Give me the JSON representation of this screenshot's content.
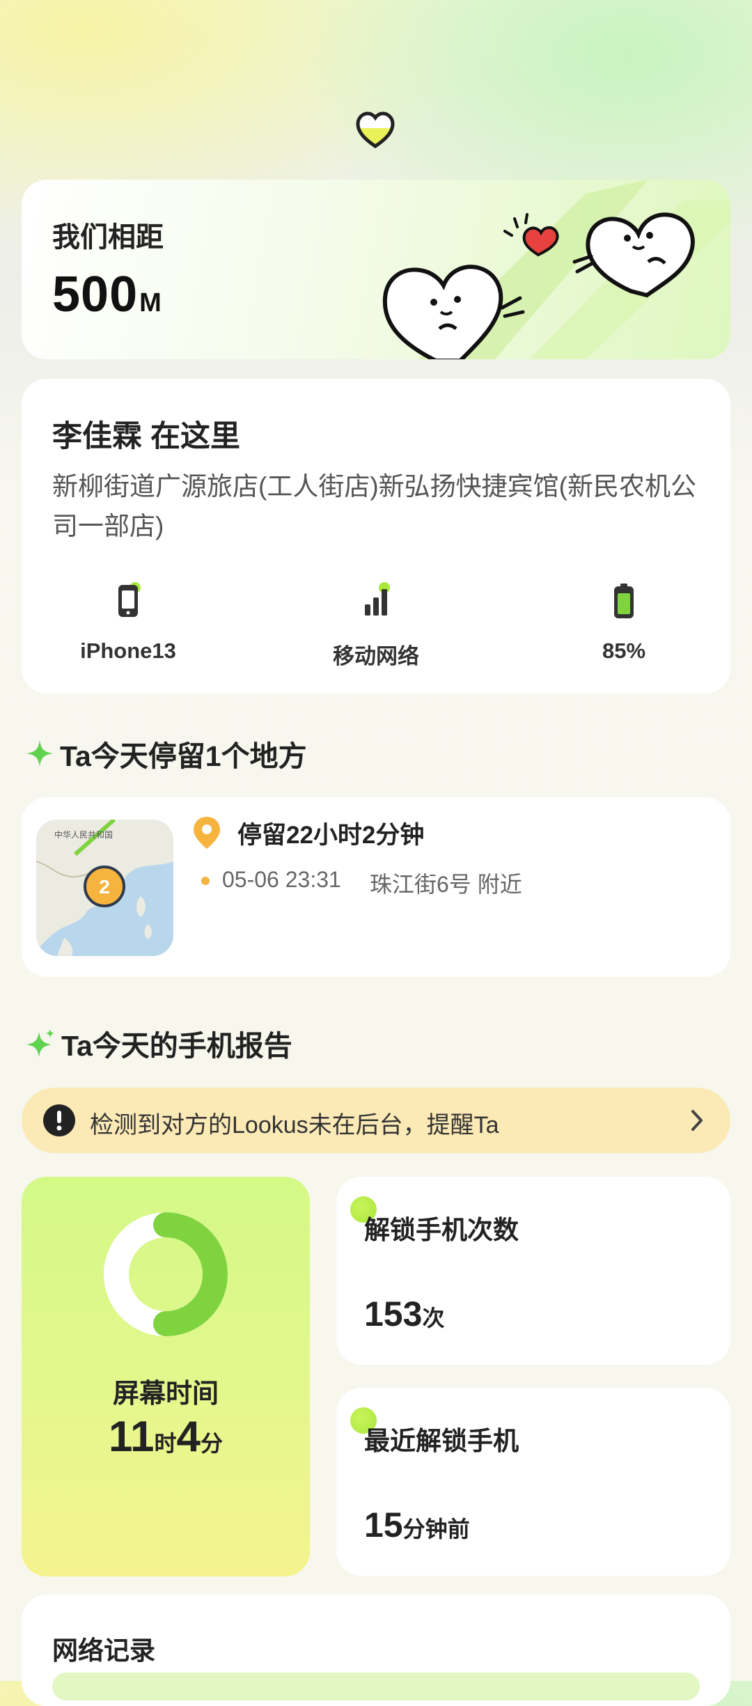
{
  "distance": {
    "title": "我们相距",
    "value": "500",
    "unit": "M"
  },
  "location": {
    "name": "李佳霖 在这里",
    "address": "新柳街道广源旅店(工人街店)新弘扬快捷宾馆(新民农机公司一部店)",
    "stats": [
      {
        "icon": "phone-icon",
        "label": "iPhone13"
      },
      {
        "icon": "signal-icon",
        "label": "移动网络"
      },
      {
        "icon": "battery-icon",
        "label": "85%"
      }
    ]
  },
  "stay_section": {
    "title": "Ta今天停留1个地方",
    "map_label": "中华人民共和国",
    "map_badge": "2",
    "duration": "停留22小时2分钟",
    "time": "05-06 23:31",
    "place": "珠江街6号 附近"
  },
  "report_section": {
    "title": "Ta今天的手机报告"
  },
  "notice": {
    "text": "检测到对方的Lookus未在后台，提醒Ta"
  },
  "screen_time": {
    "label": "屏幕时间",
    "hours": "11",
    "hours_unit": "时",
    "minutes": "4",
    "minutes_unit": "分"
  },
  "unlock_count": {
    "title": "解锁手机次数",
    "value": "153",
    "unit": "次"
  },
  "last_unlock": {
    "title": "最近解锁手机",
    "value": "15",
    "unit": "分钟前"
  },
  "network_log": {
    "title": "网络记录"
  },
  "colors": {
    "accent_green": "#7ed33f",
    "notice_bg": "#fbe9b6",
    "pin_orange": "#f6b33e"
  }
}
